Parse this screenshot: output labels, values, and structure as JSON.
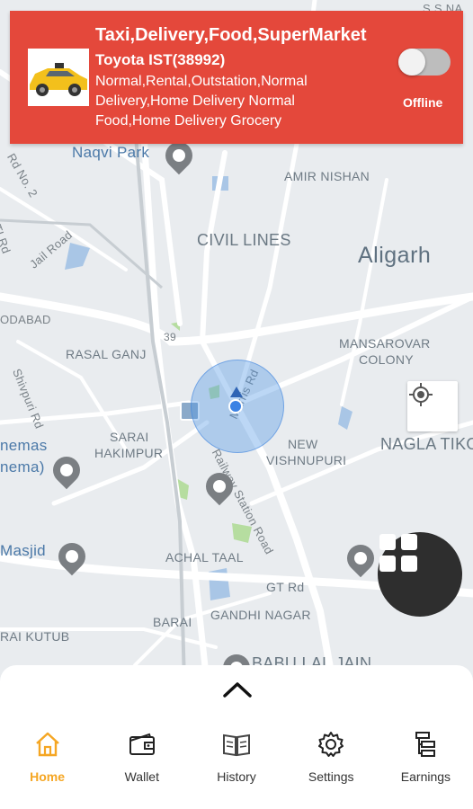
{
  "header": {
    "title": "Taxi,Delivery,Food,SuperMarket",
    "vehicle": "Toyota IST(38992)",
    "services": "Normal,Rental,Outstation,Normal Delivery,Home Delivery Normal Food,Home Delivery Grocery",
    "status": "Offline",
    "online": false,
    "accent_color": "#e4483b"
  },
  "map": {
    "labels": {
      "city": "Aligarh",
      "civil_lines": "CIVIL LINES",
      "naqvi_park": "Naqvi Park",
      "amir_nishan": "AMIR NISHAN",
      "rasal_ganj": "RASAL GANJ",
      "sarai": "SARAI",
      "hakimpur": "HAKIMPUR",
      "mansarovar": "MANSAROVAR",
      "colony": "COLONY",
      "new": "NEW",
      "vishnupuri": "VISHNUPURI",
      "nagla_tiko": "NAGLA TIKO",
      "achal_taal": "ACHAL TAAL",
      "gt_rd": "GT Rd",
      "gandhi_nagar": "GANDHI NAGAR",
      "barai": "BARAI",
      "rai_kutub": "RAI KUTUB",
      "babu_lal_jain": "BABU LAL JAIN",
      "jail_road": "Jail Road",
      "rd_no_2": "Rd No. 2",
      "iti_rd": "ITI Rd",
      "shivpuri_rd": "Shivpuri Rd",
      "railway_station_road": "Railway Station Road",
      "marris_rd": "Marris Rd",
      "odabad": "ODABAD",
      "nemas": "nemas",
      "nema": "nema)",
      "masjid": "Masjid",
      "road_39": "39",
      "ssna": "S S NA"
    }
  },
  "nav": {
    "items": [
      {
        "label": "Home",
        "icon": "home-icon",
        "active": true
      },
      {
        "label": "Wallet",
        "icon": "wallet-icon",
        "active": false
      },
      {
        "label": "History",
        "icon": "history-book-icon",
        "active": false
      },
      {
        "label": "Settings",
        "icon": "gear-icon",
        "active": false
      },
      {
        "label": "Earnings",
        "icon": "earnings-icon",
        "active": false
      }
    ],
    "active_color": "#f5a623"
  }
}
